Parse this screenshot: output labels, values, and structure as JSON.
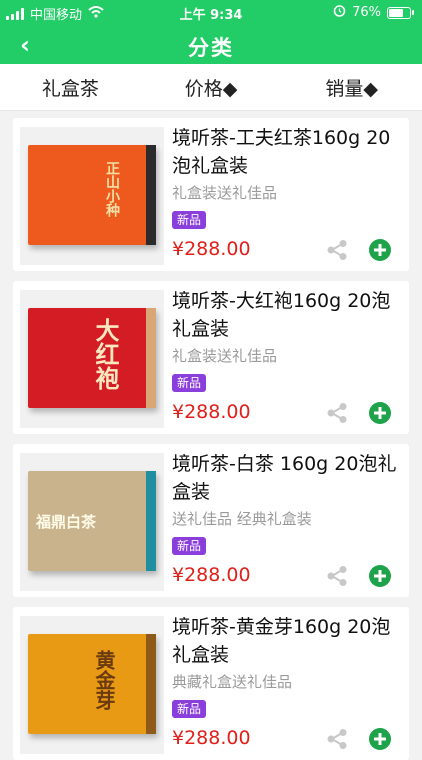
{
  "status_bar": {
    "carrier": "中国移动",
    "time": "上午 9:34",
    "battery_percent": "76%",
    "battery_level": 0.76
  },
  "nav": {
    "title": "分类",
    "back_icon": "chevron-left-icon"
  },
  "sort_bar": {
    "items": [
      {
        "label": "礼盒茶"
      },
      {
        "label": "价格◆"
      },
      {
        "label": "销量◆"
      }
    ]
  },
  "products": [
    {
      "name": "境听茶-工夫红茶160g 20泡礼盒装",
      "desc": "礼盒装送礼佳品",
      "badge": "新品",
      "price": "¥288.00",
      "box_color": "#ee5a1e",
      "box_text": "正山小种",
      "box_text_color": "#f6e0a6",
      "box_edge": "#2b2b2b"
    },
    {
      "name": "境听茶-大红袍160g 20泡礼盒装",
      "desc": "礼盒装送礼佳品",
      "badge": "新品",
      "price": "¥288.00",
      "box_color": "#d31c24",
      "box_text": "大红袍",
      "box_text_color": "#fbe7c0",
      "box_edge": "#d9a676"
    },
    {
      "name": "境听茶-白茶 160g 20泡礼盒装",
      "desc": "送礼佳品 经典礼盒装",
      "badge": "新品",
      "price": "¥288.00",
      "box_color": "#c9b38c",
      "box_text": "福鼎白茶",
      "box_text_color": "#fffbe8",
      "box_edge": "#1f8fa0"
    },
    {
      "name": "境听茶-黄金芽160g 20泡礼盒装",
      "desc": "典藏礼盒送礼佳品",
      "badge": "新品",
      "price": "¥288.00",
      "box_color": "#e99a14",
      "box_text": "黄金芽",
      "box_text_color": "#6b3a0f",
      "box_edge": "#8f5a18"
    }
  ]
}
